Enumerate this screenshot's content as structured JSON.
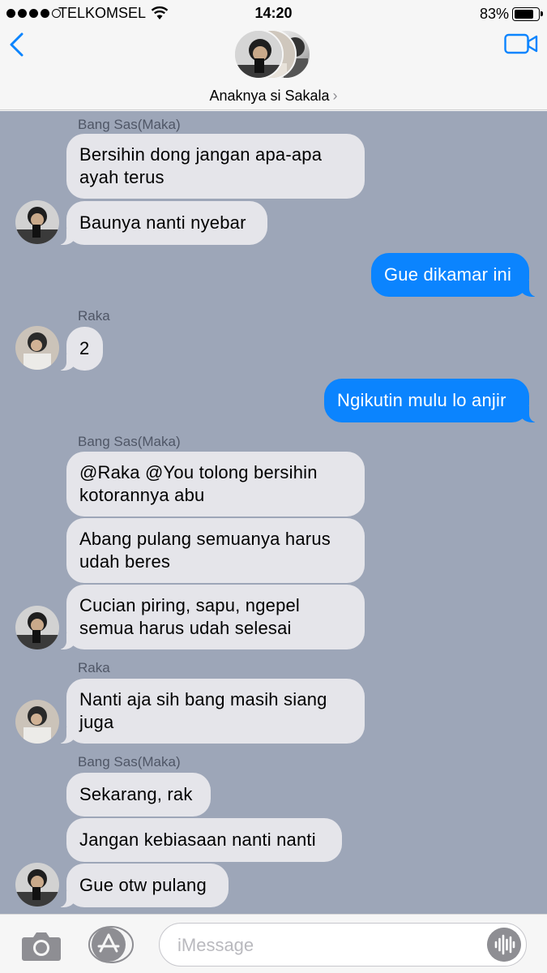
{
  "status_bar": {
    "carrier": "TELKOMSEL",
    "time": "14:20",
    "battery_percent": "83%",
    "battery_level": 0.83,
    "signal_bars": 4
  },
  "header": {
    "group_name": "Anaknya si Sakala",
    "back_icon": "chevron-left-icon",
    "video_icon": "video-camera-icon",
    "chevron": "›"
  },
  "messages": [
    {
      "sender_label": "Bang Sas(Maka)"
    },
    {
      "text": "Bersihin dong jangan apa-apa ayah terus",
      "direction": "incoming"
    },
    {
      "text": "Baunya nanti nyebar",
      "direction": "incoming"
    },
    {
      "text": "Gue dikamar ini",
      "direction": "outgoing"
    },
    {
      "sender_label": "Raka"
    },
    {
      "text": "2",
      "direction": "incoming"
    },
    {
      "text": "Ngikutin mulu lo anjir",
      "direction": "outgoing"
    },
    {
      "sender_label": "Bang Sas(Maka)"
    },
    {
      "text": "@Raka @You tolong bersihin kotorannya abu",
      "direction": "incoming"
    },
    {
      "text": "Abang pulang semuanya harus udah beres",
      "direction": "incoming"
    },
    {
      "text": "Cucian piring, sapu, ngepel semua harus udah selesai",
      "direction": "incoming"
    },
    {
      "sender_label": "Raka"
    },
    {
      "text": "Nanti aja sih bang masih siang juga",
      "direction": "incoming"
    },
    {
      "sender_label": "Bang Sas(Maka)"
    },
    {
      "text": "Sekarang, rak",
      "direction": "incoming"
    },
    {
      "text": "Jangan kebiasaan nanti nanti",
      "direction": "incoming"
    },
    {
      "text": "Gue otw pulang",
      "direction": "incoming"
    }
  ],
  "input_bar": {
    "placeholder": "iMessage",
    "camera_icon": "camera-icon",
    "appstore_icon": "app-store-icon",
    "audio_icon": "audio-waveform-icon"
  },
  "colors": {
    "chat_background": "#9da6b8",
    "incoming_bubble": "#e5e5ea",
    "outgoing_bubble": "#0b84fe",
    "accent": "#0b84fe"
  }
}
